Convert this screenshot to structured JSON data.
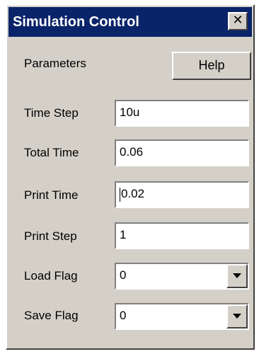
{
  "window": {
    "title": "Simulation Control",
    "close_glyph": "✕"
  },
  "parameters": {
    "heading": "Parameters",
    "help_label": "Help"
  },
  "fields": {
    "time_step": {
      "label": "Time Step",
      "value": "10u"
    },
    "total_time": {
      "label": "Total Time",
      "value": "0.06"
    },
    "print_time": {
      "label": "Print Time",
      "value": "0.02"
    },
    "print_step": {
      "label": "Print Step",
      "value": "1"
    },
    "load_flag": {
      "label": "Load Flag",
      "value": "0"
    },
    "save_flag": {
      "label": "Save Flag",
      "value": "0"
    }
  },
  "colors": {
    "titlebar": "#0a246a",
    "face": "#d4d0c8"
  },
  "icons": {
    "close": "close-icon",
    "dropdown": "chevron-down-icon"
  }
}
